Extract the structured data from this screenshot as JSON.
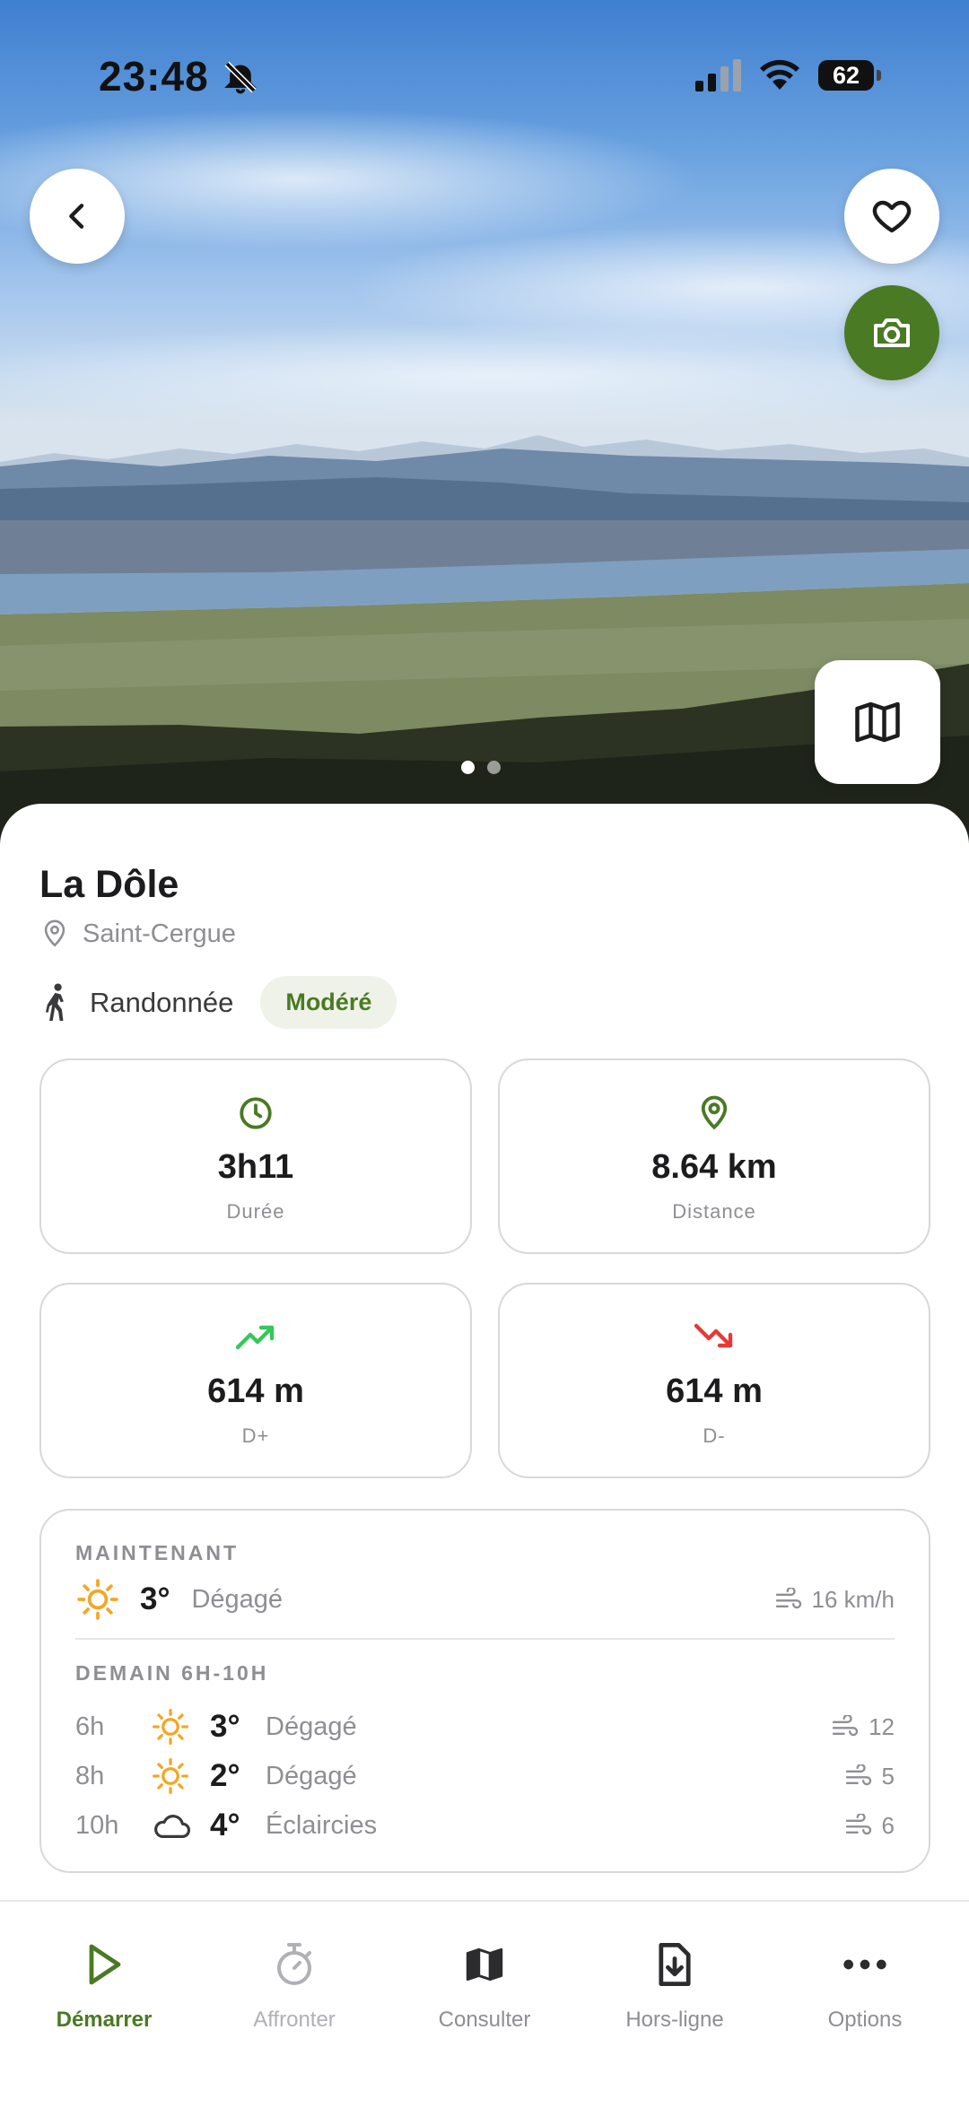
{
  "status_bar": {
    "time": "23:48",
    "battery": "62"
  },
  "trail": {
    "name": "La Dôle",
    "location": "Saint-Cergue",
    "activity": "Randonnée",
    "difficulty": "Modéré"
  },
  "stats": [
    {
      "value": "3h11",
      "label": "Durée",
      "icon": "clock-icon"
    },
    {
      "value": "8.64 km",
      "label": "Distance",
      "icon": "location-pin-icon"
    },
    {
      "value": "614 m",
      "label": "D+",
      "icon": "trending-up-icon"
    },
    {
      "value": "614 m",
      "label": "D-",
      "icon": "trending-down-icon"
    }
  ],
  "weather": {
    "now_header": "MAINTENANT",
    "now": {
      "temp": "3°",
      "desc": "Dégagé",
      "wind": "16 km/h",
      "icon": "sun-icon"
    },
    "tomorrow_header": "DEMAIN 6H-10H",
    "tomorrow": [
      {
        "hour": "6h",
        "temp": "3°",
        "desc": "Dégagé",
        "wind": "12",
        "icon": "sun-icon"
      },
      {
        "hour": "8h",
        "temp": "2°",
        "desc": "Dégagé",
        "wind": "5",
        "icon": "sun-icon"
      },
      {
        "hour": "10h",
        "temp": "4°",
        "desc": "Éclaircies",
        "wind": "6",
        "icon": "cloud-icon"
      }
    ]
  },
  "tabs": [
    {
      "label": "Démarrer",
      "icon": "play-icon",
      "state": "active"
    },
    {
      "label": "Affronter",
      "icon": "stopwatch-icon",
      "state": "disabled"
    },
    {
      "label": "Consulter",
      "icon": "map-icon",
      "state": "normal"
    },
    {
      "label": "Hors-ligne",
      "icon": "download-icon",
      "state": "normal"
    },
    {
      "label": "Options",
      "icon": "more-icon",
      "state": "normal"
    }
  ],
  "carousel": {
    "count": 2,
    "active": 1
  },
  "colors": {
    "accent": "#4a7a24",
    "up": "#34c759",
    "down": "#e53935",
    "sun": "#f5a623"
  }
}
